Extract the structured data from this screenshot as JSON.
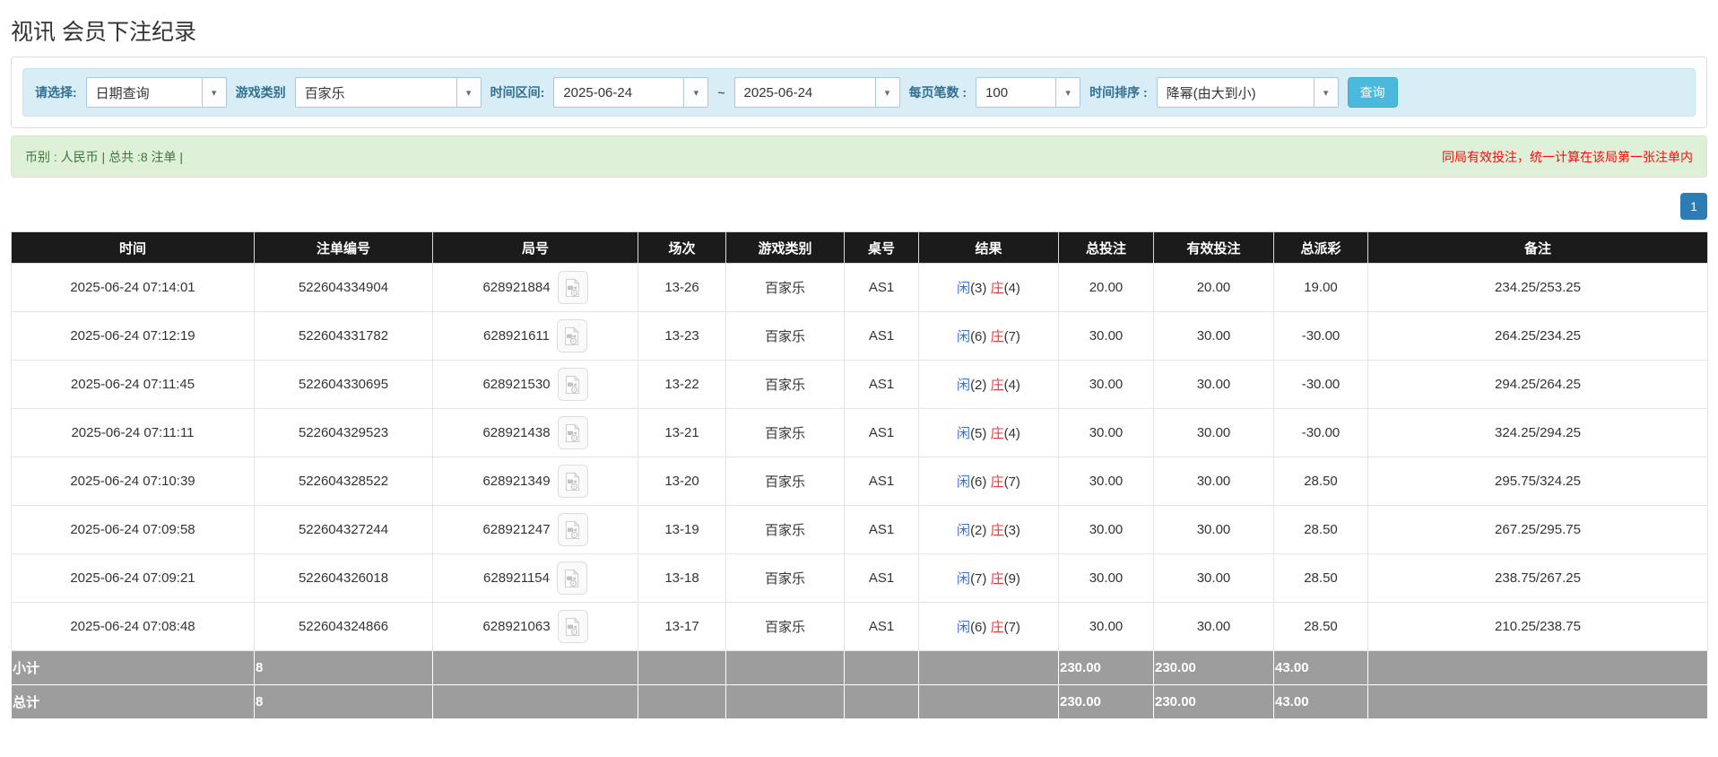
{
  "page": {
    "title": "视讯 会员下注纪录"
  },
  "icons": {
    "combo_arrow": "▾"
  },
  "filters": {
    "query_type": {
      "label": "请选择:",
      "value": "日期查询"
    },
    "game_type": {
      "label": "游戏类别",
      "value": "百家乐"
    },
    "date_range": {
      "label": "时间区间:",
      "from": "2025-06-24",
      "separator": "~",
      "to": "2025-06-24"
    },
    "page_size": {
      "label": "每页笔数 :",
      "value": "100"
    },
    "time_sort": {
      "label": "时间排序 :",
      "value": "降幂(由大到小)"
    },
    "search_button": "查询"
  },
  "summary": {
    "left": "币别 : 人民币 | 总共 :8 注单 |",
    "right": "同局有效投注，统一计算在该局第一张注单内"
  },
  "pagination": {
    "current": "1"
  },
  "colors": {
    "accent_blue": "#2e7cb5",
    "info_bg": "#d9edf7",
    "success_bg": "#dff0d8",
    "header_bg": "#1b1b1b",
    "summary_row_bg": "#9d9d9d",
    "negative_red": "#f23030",
    "link_blue": "#337ab7"
  },
  "table": {
    "headers": [
      "时间",
      "注单编号",
      "局号",
      "场次",
      "游戏类别",
      "桌号",
      "结果",
      "总投注",
      "有效投注",
      "总派彩",
      "备注"
    ],
    "result_labels": {
      "player": "闲",
      "banker": "庄"
    },
    "rows": [
      {
        "time": "2025-06-24 07:14:01",
        "bet_id": "522604334904",
        "round_id": "628921884",
        "session": "13-26",
        "game": "百家乐",
        "table_no": "AS1",
        "player": "3",
        "banker": "4",
        "total_bet": "20.00",
        "valid_bet": "20.00",
        "payout": "19.00",
        "remark": "234.25/253.25"
      },
      {
        "time": "2025-06-24 07:12:19",
        "bet_id": "522604331782",
        "round_id": "628921611",
        "session": "13-23",
        "game": "百家乐",
        "table_no": "AS1",
        "player": "6",
        "banker": "7",
        "total_bet": "30.00",
        "valid_bet": "30.00",
        "payout": "-30.00",
        "remark": "264.25/234.25"
      },
      {
        "time": "2025-06-24 07:11:45",
        "bet_id": "522604330695",
        "round_id": "628921530",
        "session": "13-22",
        "game": "百家乐",
        "table_no": "AS1",
        "player": "2",
        "banker": "4",
        "total_bet": "30.00",
        "valid_bet": "30.00",
        "payout": "-30.00",
        "remark": "294.25/264.25"
      },
      {
        "time": "2025-06-24 07:11:11",
        "bet_id": "522604329523",
        "round_id": "628921438",
        "session": "13-21",
        "game": "百家乐",
        "table_no": "AS1",
        "player": "5",
        "banker": "4",
        "total_bet": "30.00",
        "valid_bet": "30.00",
        "payout": "-30.00",
        "remark": "324.25/294.25"
      },
      {
        "time": "2025-06-24 07:10:39",
        "bet_id": "522604328522",
        "round_id": "628921349",
        "session": "13-20",
        "game": "百家乐",
        "table_no": "AS1",
        "player": "6",
        "banker": "7",
        "total_bet": "30.00",
        "valid_bet": "30.00",
        "payout": "28.50",
        "remark": "295.75/324.25"
      },
      {
        "time": "2025-06-24 07:09:58",
        "bet_id": "522604327244",
        "round_id": "628921247",
        "session": "13-19",
        "game": "百家乐",
        "table_no": "AS1",
        "player": "2",
        "banker": "3",
        "total_bet": "30.00",
        "valid_bet": "30.00",
        "payout": "28.50",
        "remark": "267.25/295.75"
      },
      {
        "time": "2025-06-24 07:09:21",
        "bet_id": "522604326018",
        "round_id": "628921154",
        "session": "13-18",
        "game": "百家乐",
        "table_no": "AS1",
        "player": "7",
        "banker": "9",
        "total_bet": "30.00",
        "valid_bet": "30.00",
        "payout": "28.50",
        "remark": "238.75/267.25"
      },
      {
        "time": "2025-06-24 07:08:48",
        "bet_id": "522604324866",
        "round_id": "628921063",
        "session": "13-17",
        "game": "百家乐",
        "table_no": "AS1",
        "player": "6",
        "banker": "7",
        "total_bet": "30.00",
        "valid_bet": "30.00",
        "payout": "28.50",
        "remark": "210.25/238.75"
      }
    ],
    "subtotal": {
      "label": "小计",
      "count": "8",
      "total_bet": "230.00",
      "valid_bet": "230.00",
      "payout": "43.00"
    },
    "grand_total": {
      "label": "总计",
      "count": "8",
      "total_bet": "230.00",
      "valid_bet": "230.00",
      "payout": "43.00"
    }
  }
}
